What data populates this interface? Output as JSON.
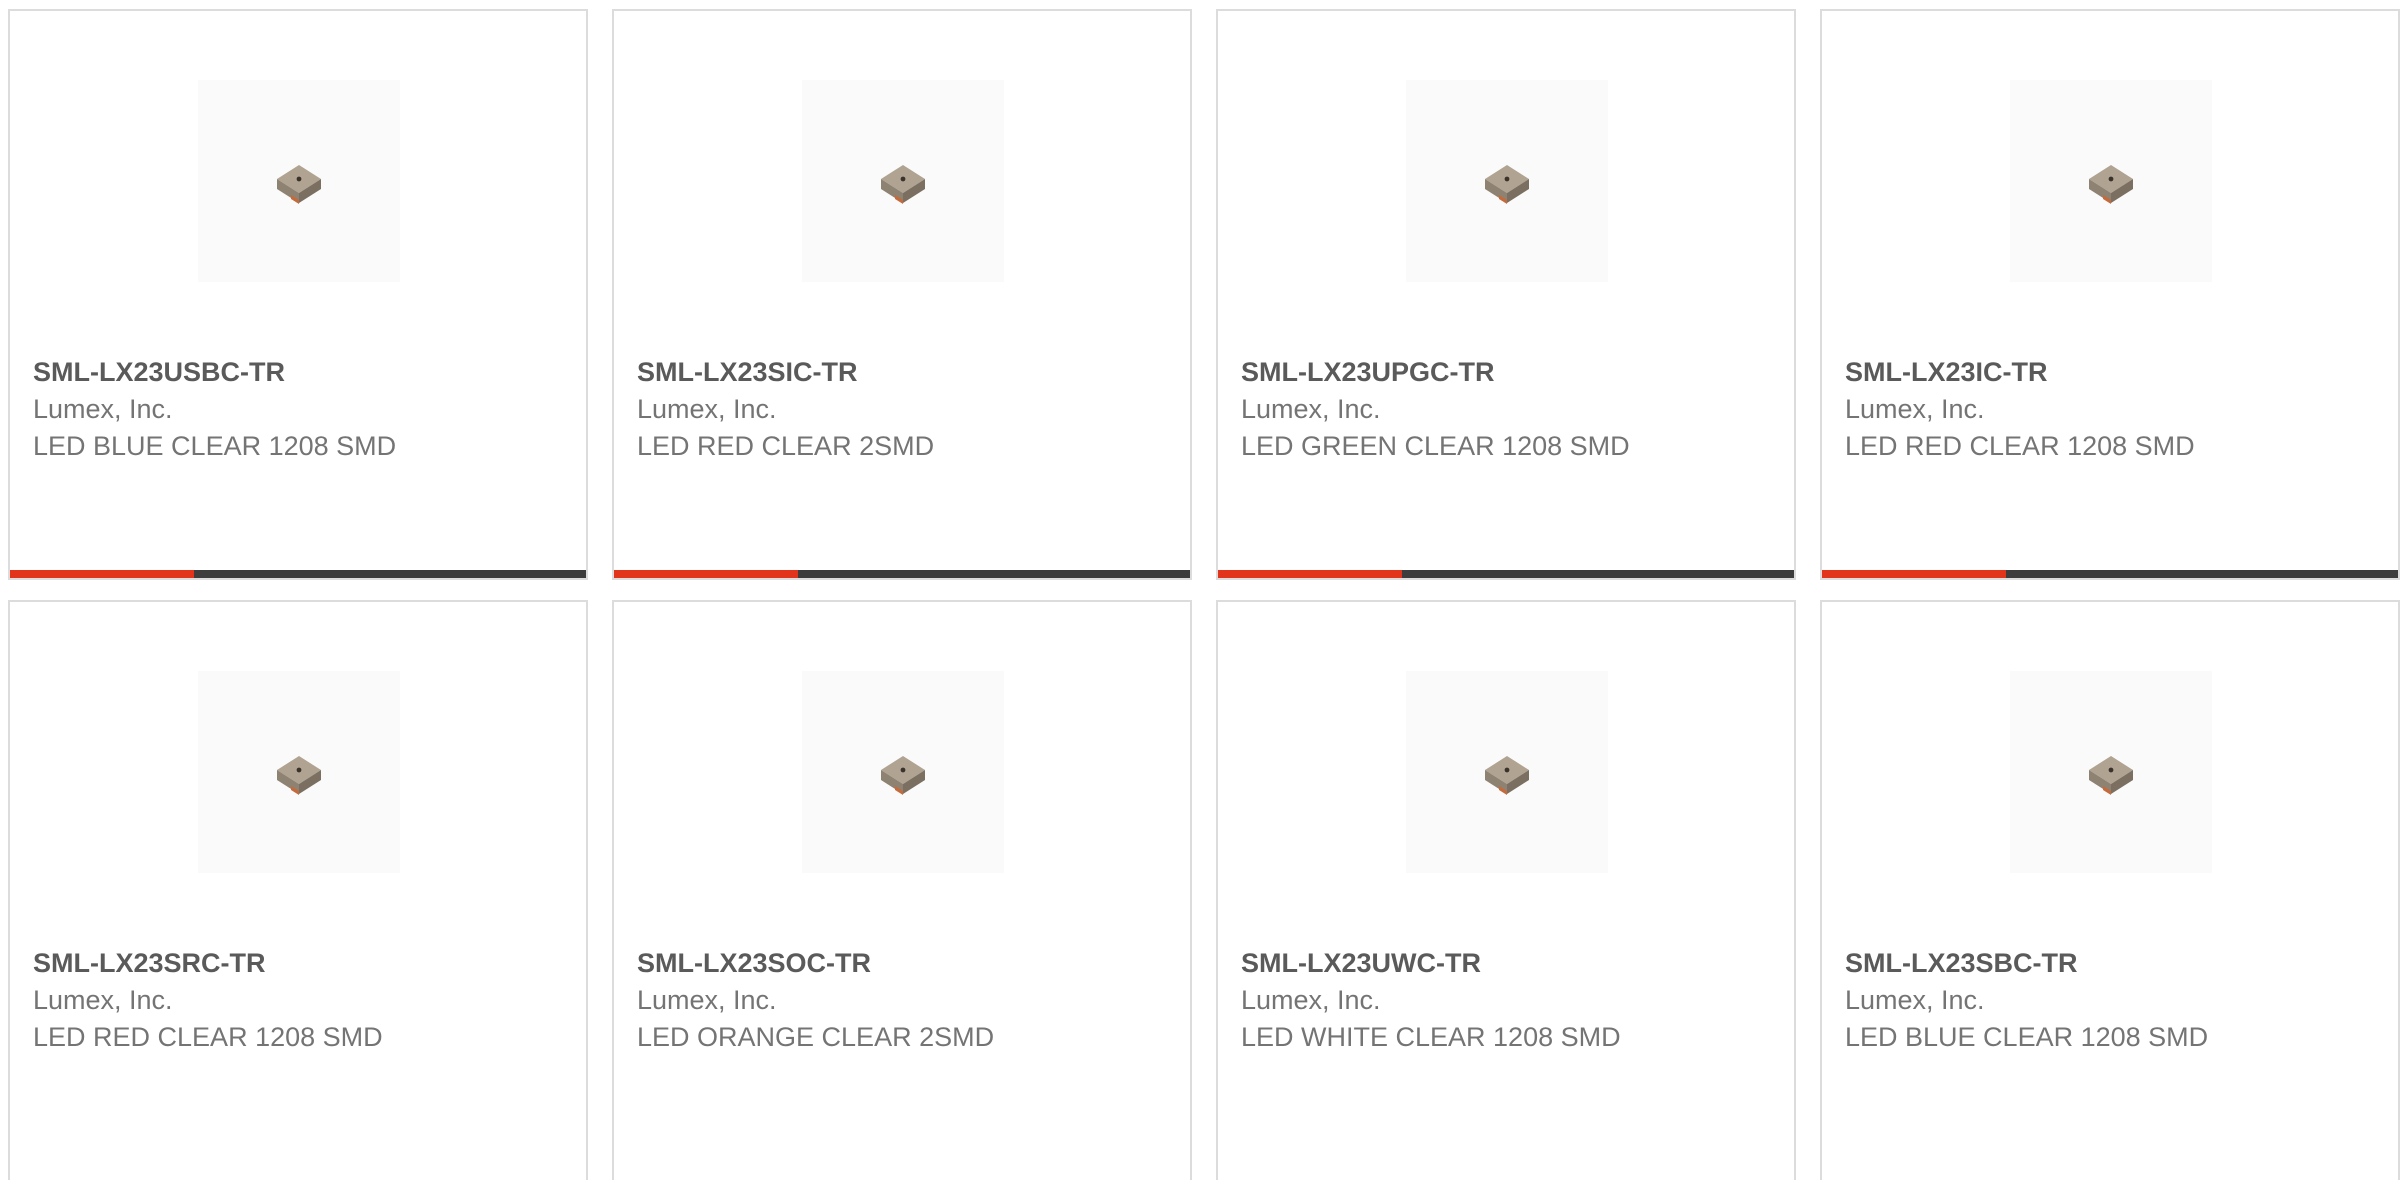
{
  "colors": {
    "accent": "#e2341a",
    "bar_track": "#3d3d3d",
    "card_border": "#dcdcdc",
    "part_text": "#5a5a5a",
    "secondary_text": "#747474"
  },
  "products": [
    {
      "part": "SML-LX23USBC-TR",
      "manufacturer": "Lumex, Inc.",
      "description": "LED BLUE CLEAR 1208 SMD",
      "image_icon": "smd-led-chip-icon",
      "progress": 0.32
    },
    {
      "part": "SML-LX23SIC-TR",
      "manufacturer": "Lumex, Inc.",
      "description": "LED RED CLEAR 2SMD",
      "image_icon": "smd-led-chip-icon",
      "progress": 0.32
    },
    {
      "part": "SML-LX23UPGC-TR",
      "manufacturer": "Lumex, Inc.",
      "description": "LED GREEN CLEAR 1208 SMD",
      "image_icon": "smd-led-chip-icon",
      "progress": 0.32
    },
    {
      "part": "SML-LX23IC-TR",
      "manufacturer": "Lumex, Inc.",
      "description": "LED RED CLEAR 1208 SMD",
      "image_icon": "smd-led-chip-icon",
      "progress": 0.32
    },
    {
      "part": "SML-LX23SRC-TR",
      "manufacturer": "Lumex, Inc.",
      "description": "LED RED CLEAR 1208 SMD",
      "image_icon": "smd-led-chip-icon"
    },
    {
      "part": "SML-LX23SOC-TR",
      "manufacturer": "Lumex, Inc.",
      "description": "LED ORANGE CLEAR 2SMD",
      "image_icon": "smd-led-chip-icon"
    },
    {
      "part": "SML-LX23UWC-TR",
      "manufacturer": "Lumex, Inc.",
      "description": "LED WHITE CLEAR 1208 SMD",
      "image_icon": "smd-led-chip-icon"
    },
    {
      "part": "SML-LX23SBC-TR",
      "manufacturer": "Lumex, Inc.",
      "description": "LED BLUE CLEAR 1208 SMD",
      "image_icon": "smd-led-chip-icon"
    }
  ]
}
